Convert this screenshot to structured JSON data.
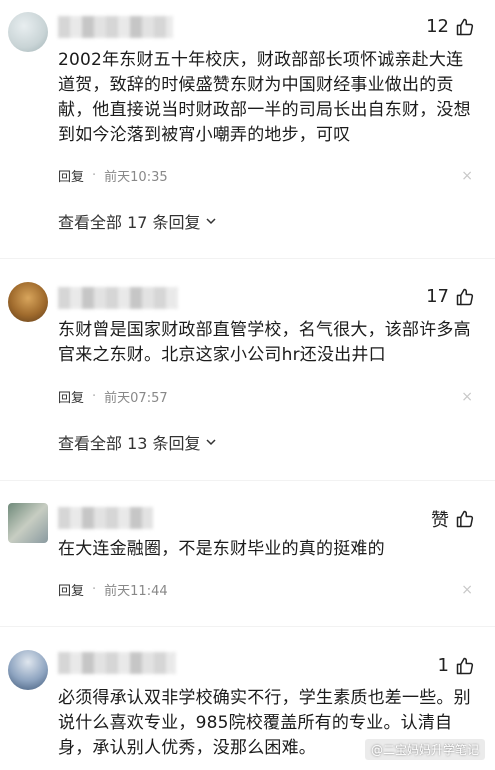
{
  "comments": [
    {
      "likes": "12",
      "text": "2002年东财五十年校庆，财政部部长项怀诚亲赴大连道贺，致辞的时候盛赞东财为中国财经事业做出的贡献，他直接说当时财政部一半的司局长出自东财，没想到如今沦落到被宵小嘲弄的地步，可叹",
      "reply_label": "回复",
      "time": "前天10:35",
      "view_replies": "查看全部 17 条回复"
    },
    {
      "likes": "17",
      "text": "东财曾是国家财政部直管学校，名气很大，该部许多高官来之东财。北京这家小公司hr还没出井口",
      "reply_label": "回复",
      "time": "前天07:57",
      "view_replies": "查看全部 13 条回复"
    },
    {
      "likes": "赞",
      "text": "在大连金融圈，不是东财毕业的真的挺难的",
      "reply_label": "回复",
      "time": "前天11:44"
    },
    {
      "likes": "1",
      "text": "必须得承认双非学校确实不行，学生素质也差一些。别说什么喜欢专业，985院校覆盖所有的专业。认清自身，承认别人优秀，没那么困难。"
    }
  ],
  "watermark": "@二宝妈妈升学笔记",
  "close_glyph": "×",
  "dot_glyph": "·"
}
